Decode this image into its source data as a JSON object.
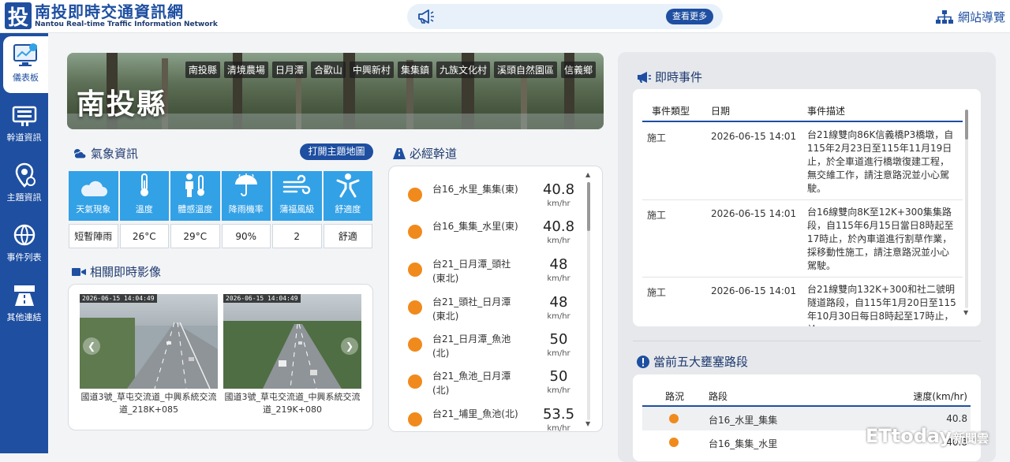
{
  "header": {
    "logo_char": "投",
    "title_zh": "南投即時交通資訊網",
    "title_en": "Nantou Real-time Traffic Information Network",
    "more_button": "查看更多",
    "site_nav": "網站導覽"
  },
  "sidebar": {
    "items": [
      {
        "label": "儀表板",
        "icon": "dashboard-icon"
      },
      {
        "label": "幹道資訊",
        "icon": "road-info-icon"
      },
      {
        "label": "主題資訊",
        "icon": "topic-info-icon"
      },
      {
        "label": "事件列表",
        "icon": "event-list-icon"
      },
      {
        "label": "其他連結",
        "icon": "other-links-icon"
      }
    ]
  },
  "banner": {
    "title": "南投縣",
    "tabs": [
      "南投縣",
      "清境農場",
      "日月潭",
      "合歡山",
      "中興新村",
      "集集鎮",
      "九族文化村",
      "溪頭自然園區",
      "信義鄉"
    ]
  },
  "weather": {
    "title": "氣象資訊",
    "map_button": "打開主題地圖",
    "headers": [
      "天氣現象",
      "溫度",
      "體感溫度",
      "降雨機率",
      "蒲福風級",
      "舒適度"
    ],
    "values": [
      "短暫陣雨",
      "26°C",
      "29°C",
      "90%",
      "2",
      "舒適"
    ]
  },
  "cameras": {
    "title": "相關即時影像",
    "items": [
      {
        "timestamp": "2026-06-15 14:04:49",
        "caption": "國道3號_草屯交流道_中興系統交流道_218K+085"
      },
      {
        "timestamp": "2026-06-15 14:04:49",
        "caption": "國道3號_草屯交流道_中興系統交流道_219K+080"
      }
    ]
  },
  "roads": {
    "title": "必經幹道",
    "unit": "km/hr",
    "items": [
      {
        "name": "台16_水里_集集(東)",
        "speed": "40.8"
      },
      {
        "name": "台16_集集_水里(東)",
        "speed": "40.8"
      },
      {
        "name": "台21_日月潭_頭社(東北)",
        "speed": "48"
      },
      {
        "name": "台21_頭社_日月潭(東北)",
        "speed": "48"
      },
      {
        "name": "台21_日月潭_魚池(北)",
        "speed": "50"
      },
      {
        "name": "台21_魚池_日月潭(北)",
        "speed": "50"
      },
      {
        "name": "台21_埔里_魚池(北)",
        "speed": "53.5"
      }
    ]
  },
  "events": {
    "title": "即時事件",
    "headers": [
      "事件類型",
      "日期",
      "事件描述"
    ],
    "rows": [
      {
        "type": "施工",
        "date": "2026-06-15 14:01",
        "desc": "台21線雙向86K信義橋P3橋墩，自115年2月23日至115年11月19日止，於全車道進行橋墩復建工程，無交維工作，請注意路況並小心駕駛。"
      },
      {
        "type": "施工",
        "date": "2026-06-15 14:01",
        "desc": "台16線雙向8K至12K+300集集路段，自115年6月15日當日8時起至17時止，於內車道進行割草作業，採移動性施工，請注意路況並小心駕駛。"
      },
      {
        "type": "施工",
        "date": "2026-06-15 14:01",
        "desc": "台21線雙向132K+300和社二號明隧道路段，自115年1月20日至115年10月30日每日8時起至17時止，於"
      }
    ]
  },
  "congestion": {
    "title": "當前五大壅塞路段",
    "headers": [
      "路況",
      "路段",
      "速度(km/hr)"
    ],
    "rows": [
      {
        "name": "台16_水里_集集",
        "speed": "40.8"
      },
      {
        "name": "台16_集集_水里",
        "speed": "40.8"
      }
    ]
  },
  "watermark": {
    "text": "ETtoday",
    "suffix": "新聞雲"
  },
  "colors": {
    "primary": "#1e4fa1",
    "weather_cell": "#33a1e6",
    "status_dot": "#f08a1c"
  }
}
